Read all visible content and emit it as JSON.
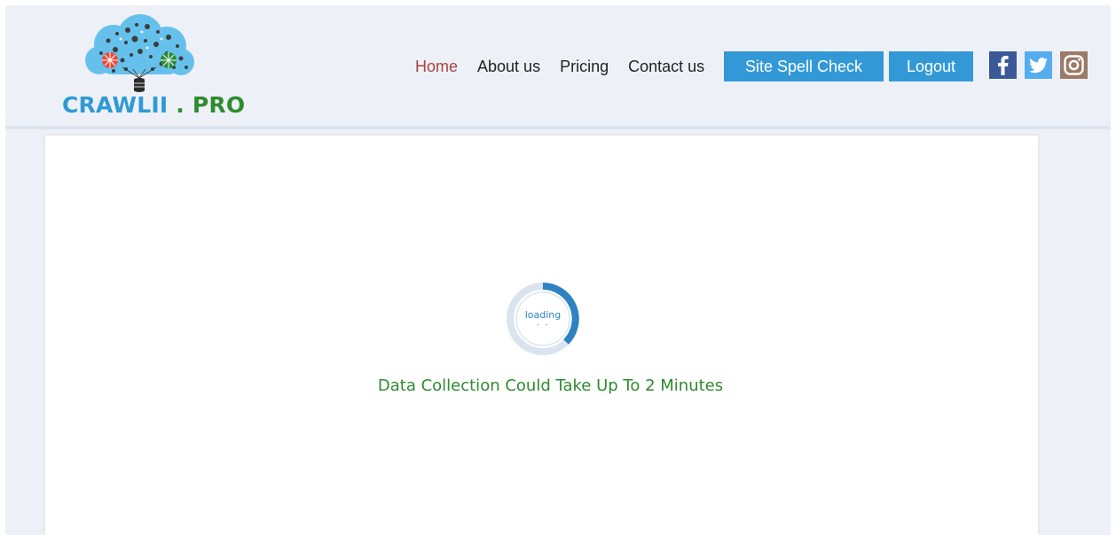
{
  "brand": {
    "name_part1": "CRAWLII",
    "name_part2": " . PRO",
    "color_blue": "#2f9ad3",
    "color_green": "#2e8b2e",
    "logo_icon": "cloud-network-database-icon"
  },
  "nav": {
    "items": [
      {
        "label": "Home",
        "active": true
      },
      {
        "label": "About us",
        "active": false
      },
      {
        "label": "Pricing",
        "active": false
      },
      {
        "label": "Contact us",
        "active": false
      }
    ],
    "buttons": {
      "spell_check": "Site Spell Check",
      "logout": "Logout"
    },
    "button_color": "#3399d6",
    "active_color": "#a8433f"
  },
  "social": {
    "facebook": {
      "icon": "facebook-icon",
      "glyph": "f",
      "color": "#3b5998"
    },
    "twitter": {
      "icon": "twitter-icon",
      "color": "#55acee"
    },
    "instagram": {
      "icon": "instagram-icon",
      "color": "#9c7a67"
    }
  },
  "loader": {
    "text": "loading",
    "dots": "• •"
  },
  "message": "Data Collection Could Take Up To 2 Minutes"
}
